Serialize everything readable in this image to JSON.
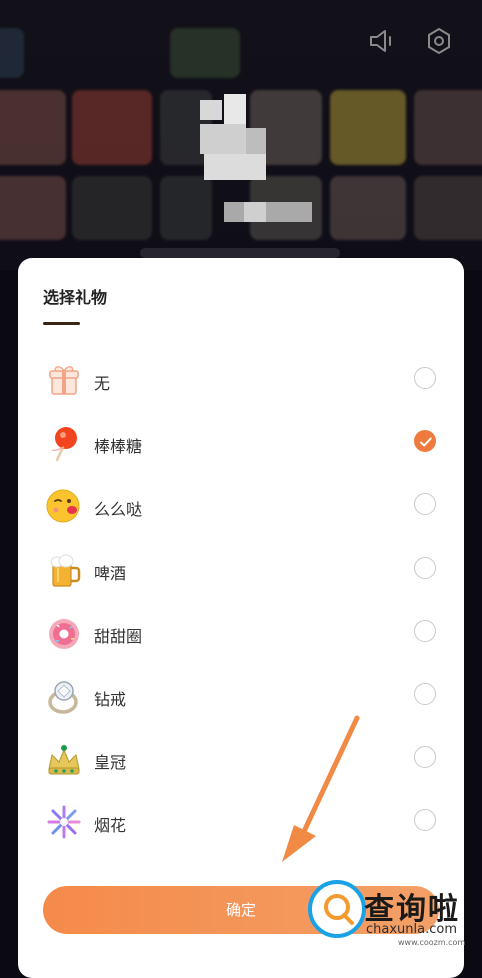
{
  "header_icons": [
    "speaker-icon",
    "settings-icon"
  ],
  "background_tiles": [
    {
      "color": "#5a3a38"
    },
    {
      "color": "#6c2f2b"
    },
    {
      "color": "#2e2f33"
    },
    {
      "color": "#4e4744"
    },
    {
      "color": "#7d6e2e"
    },
    {
      "color": "#4a3a3a"
    },
    {
      "color": "#563a3a"
    },
    {
      "color": "#2c2c2c"
    },
    {
      "color": "#2b2d30"
    },
    {
      "color": "#42403d"
    },
    {
      "color": "#4a4040"
    },
    {
      "color": "#3b3434"
    }
  ],
  "dialog": {
    "title": "选择礼物",
    "options": [
      {
        "label": "无",
        "icon": "gift-box-icon",
        "selected": false
      },
      {
        "label": "棒棒糖",
        "icon": "lollipop-icon",
        "selected": true
      },
      {
        "label": "么么哒",
        "icon": "kiss-face-icon",
        "selected": false
      },
      {
        "label": "啤酒",
        "icon": "beer-mug-icon",
        "selected": false
      },
      {
        "label": "甜甜圈",
        "icon": "donut-icon",
        "selected": false
      },
      {
        "label": "钻戒",
        "icon": "diamond-ring-icon",
        "selected": false
      },
      {
        "label": "皇冠",
        "icon": "crown-icon",
        "selected": false
      },
      {
        "label": "烟花",
        "icon": "fireworks-icon",
        "selected": false
      }
    ],
    "confirm_label": "确定"
  },
  "watermark": {
    "title": "查询啦",
    "subtitle": "chaxunla.com",
    "site": "www.coozm.com"
  },
  "accent": "#ef7a3e",
  "annotation_arrow_color": "#f08a45"
}
